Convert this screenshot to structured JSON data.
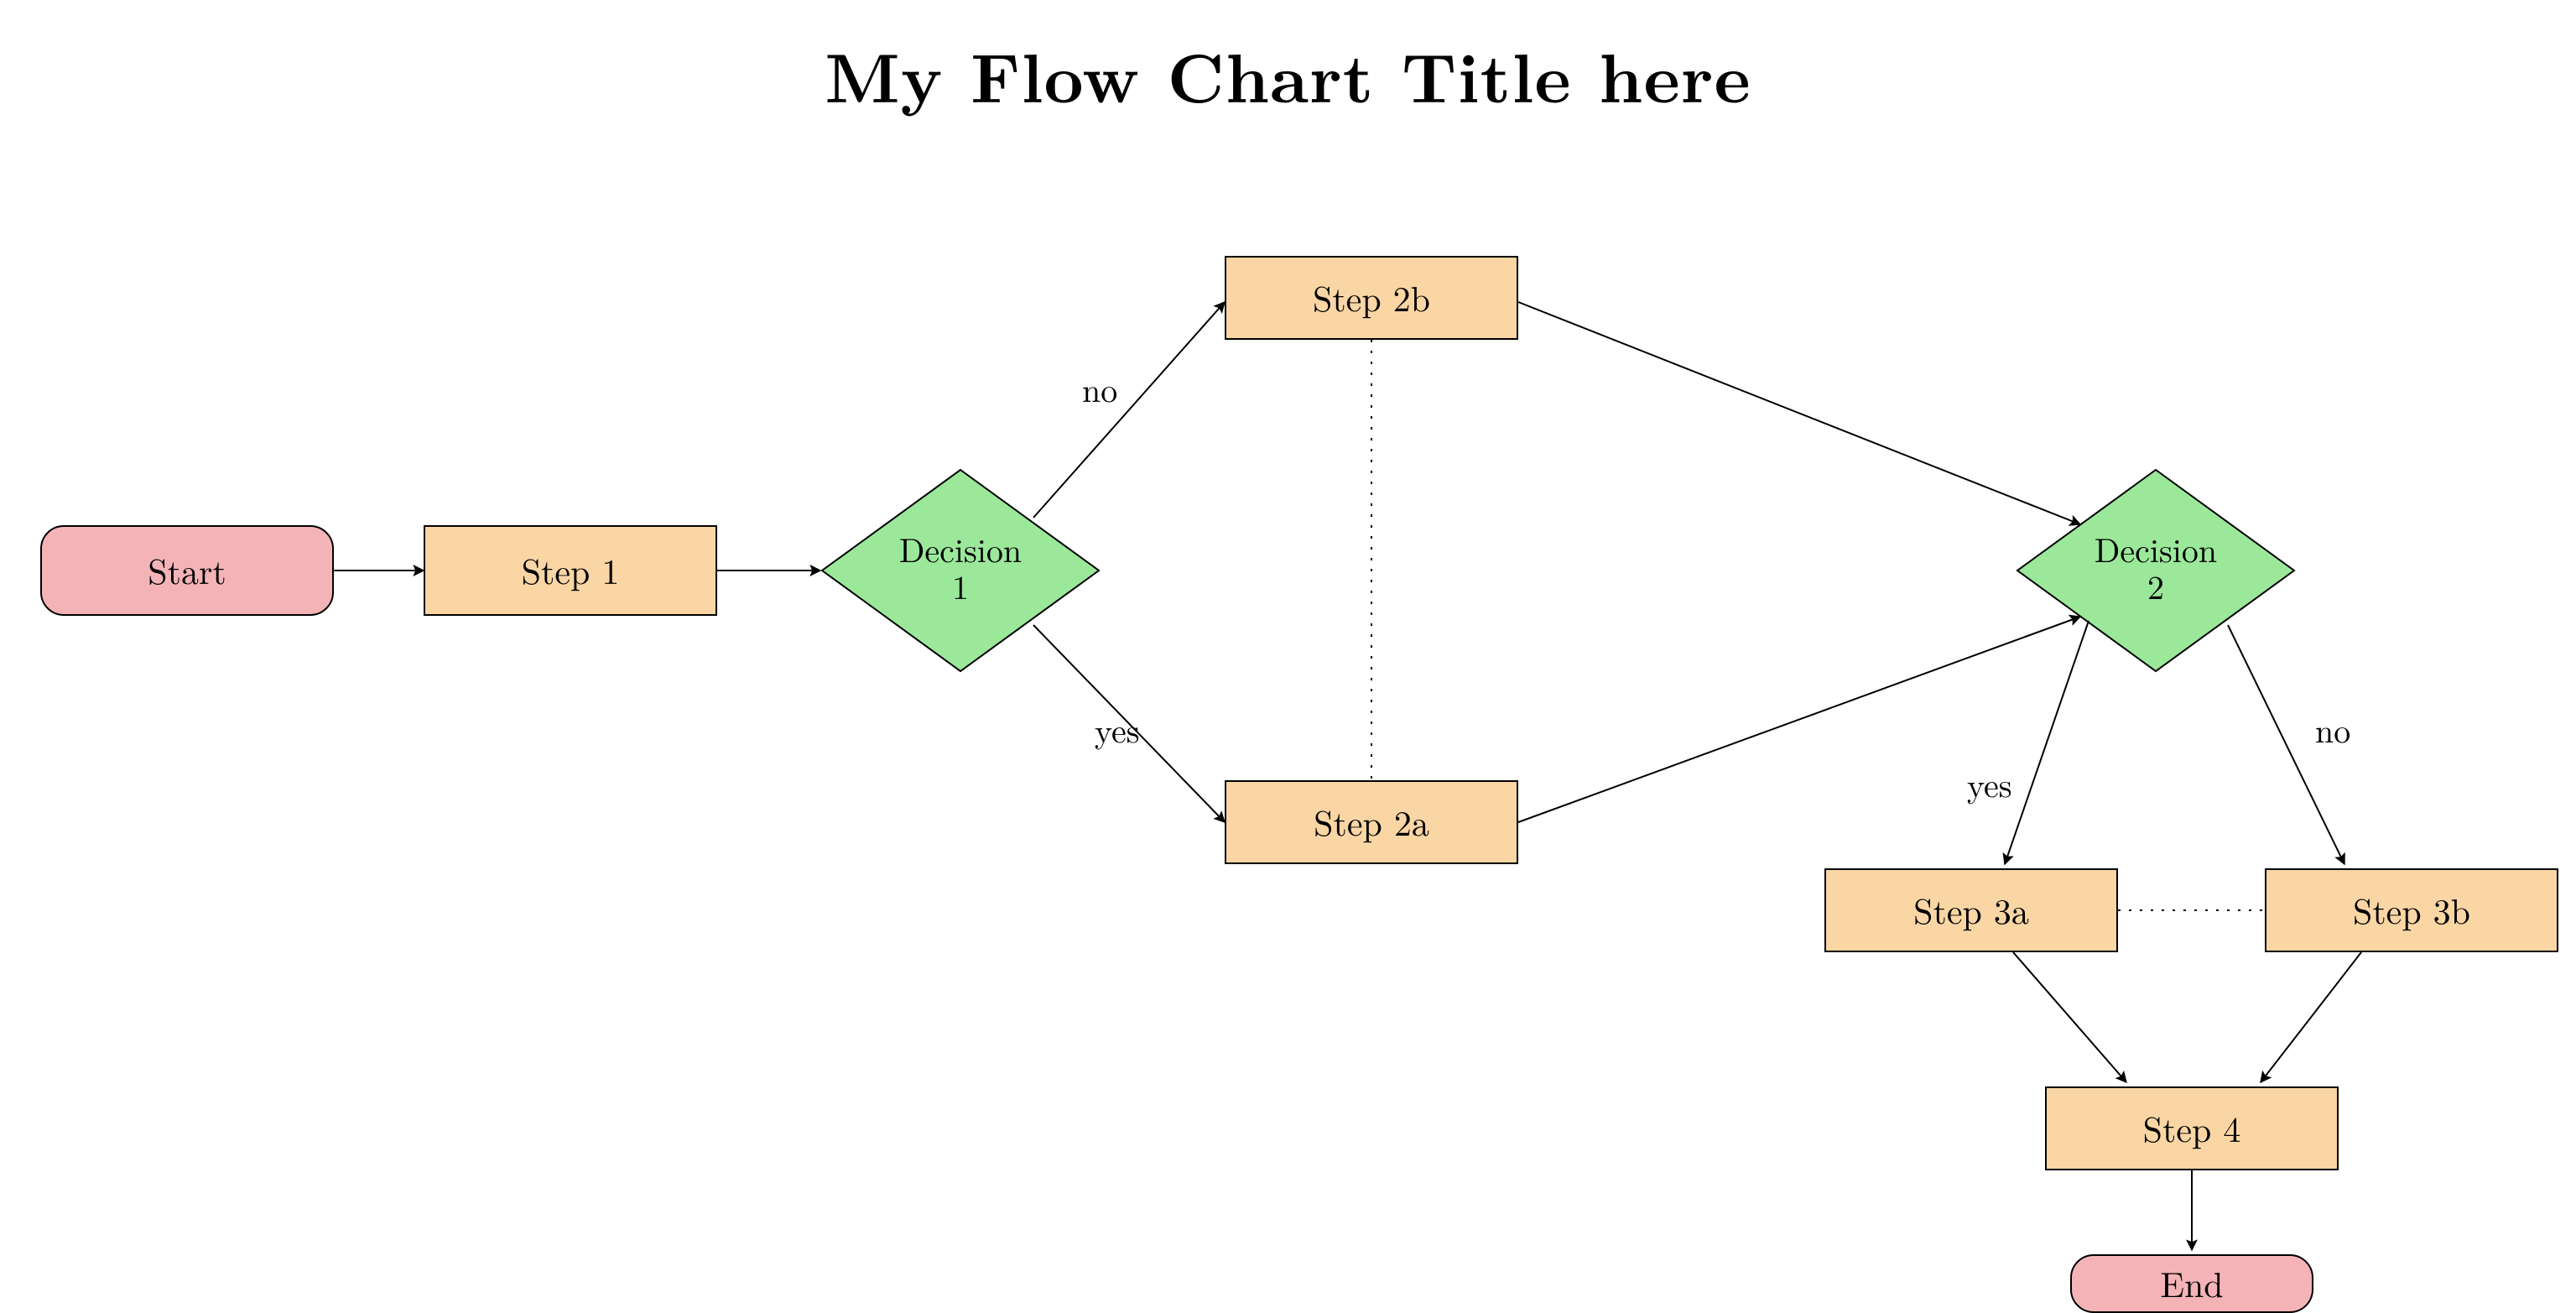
{
  "title": "My Flow Chart Title here",
  "nodes": {
    "start": {
      "label": "Start",
      "type": "terminal"
    },
    "step1": {
      "label": "Step 1",
      "type": "process"
    },
    "dec1": {
      "line1": "Decision",
      "line2": "1",
      "type": "decision"
    },
    "step2b": {
      "label": "Step 2b",
      "type": "process"
    },
    "step2a": {
      "label": "Step 2a",
      "type": "process"
    },
    "dec2": {
      "line1": "Decision",
      "line2": "2",
      "type": "decision"
    },
    "step3a": {
      "label": "Step 3a",
      "type": "process"
    },
    "step3b": {
      "label": "Step 3b",
      "type": "process"
    },
    "step4": {
      "label": "Step 4",
      "type": "process"
    },
    "end": {
      "label": "End",
      "type": "terminal"
    }
  },
  "edges": [
    {
      "from": "start",
      "to": "step1"
    },
    {
      "from": "step1",
      "to": "dec1"
    },
    {
      "from": "dec1",
      "to": "step2b",
      "label": "no"
    },
    {
      "from": "dec1",
      "to": "step2a",
      "label": "yes"
    },
    {
      "from": "step2b",
      "to": "step2a",
      "style": "dotted"
    },
    {
      "from": "step2b",
      "to": "dec2"
    },
    {
      "from": "step2a",
      "to": "dec2"
    },
    {
      "from": "dec2",
      "to": "step3a",
      "label": "yes"
    },
    {
      "from": "dec2",
      "to": "step3b",
      "label": "no"
    },
    {
      "from": "step3a",
      "to": "step3b",
      "style": "dotted"
    },
    {
      "from": "step3a",
      "to": "step4"
    },
    {
      "from": "step3b",
      "to": "step4"
    },
    {
      "from": "step4",
      "to": "end"
    }
  ],
  "edge_labels": {
    "no1": "no",
    "yes1": "yes",
    "yes2": "yes",
    "no2": "no"
  },
  "colors": {
    "terminal": "#f4b4b7",
    "process": "#fad6a5",
    "decision": "#9be89b",
    "stroke": "#000000"
  }
}
